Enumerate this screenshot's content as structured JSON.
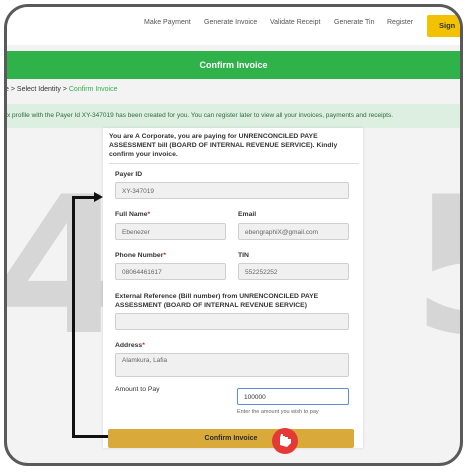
{
  "steps": {
    "left": "4",
    "right": "5"
  },
  "nav": {
    "make_payment": "Make Payment",
    "generate_invoice": "Generate Invoice",
    "validate_receipt": "Validate Receipt",
    "generate_tin": "Generate Tin",
    "register": "Register",
    "signup": "Sign"
  },
  "page_title": "Confirm Invoice",
  "breadcrumb": {
    "home": "e",
    "sep1": ">",
    "select_identity": "Select Identity",
    "sep2": ">",
    "current": "Confirm Invoice"
  },
  "notice": "x profile with the Payer Id XY-347019 has been created for you. You can register later to view all your invoices, payments and receipts.",
  "intro": "You are A Corporate, you are paying for UNRENCONCILED PAYE ASSESSMENT bill (BOARD OF INTERNAL REVENUE SERVICE). Kindly confirm your invoice.",
  "form": {
    "payer_id_label": "Payer ID",
    "payer_id_value": "XY-347019",
    "full_name_label": "Full Name",
    "full_name_value": "Ebenezer",
    "email_label": "Email",
    "email_value": "ebengraphiX@gmail.com",
    "phone_label": "Phone Number",
    "phone_value": "08064461617",
    "tin_label": "TIN",
    "tin_value": "552252252",
    "ext_ref_label": "External Reference (Bill number) from UNRENCONCILED PAYE ASSESSMENT (BOARD OF INTERNAL REVENUE SERVICE)",
    "ext_ref_value": "",
    "address_label": "Address",
    "address_value": "Alamkura, Lafia",
    "amount_label": "Amount to Pay",
    "amount_value": "100000",
    "amount_hint": "Enter the amount you wish to pay",
    "required_mark": "*"
  },
  "confirm_button": "Confirm Invoice",
  "colors": {
    "green": "#2fb24a",
    "button": "#d9a93a",
    "signup": "#f2c200"
  }
}
